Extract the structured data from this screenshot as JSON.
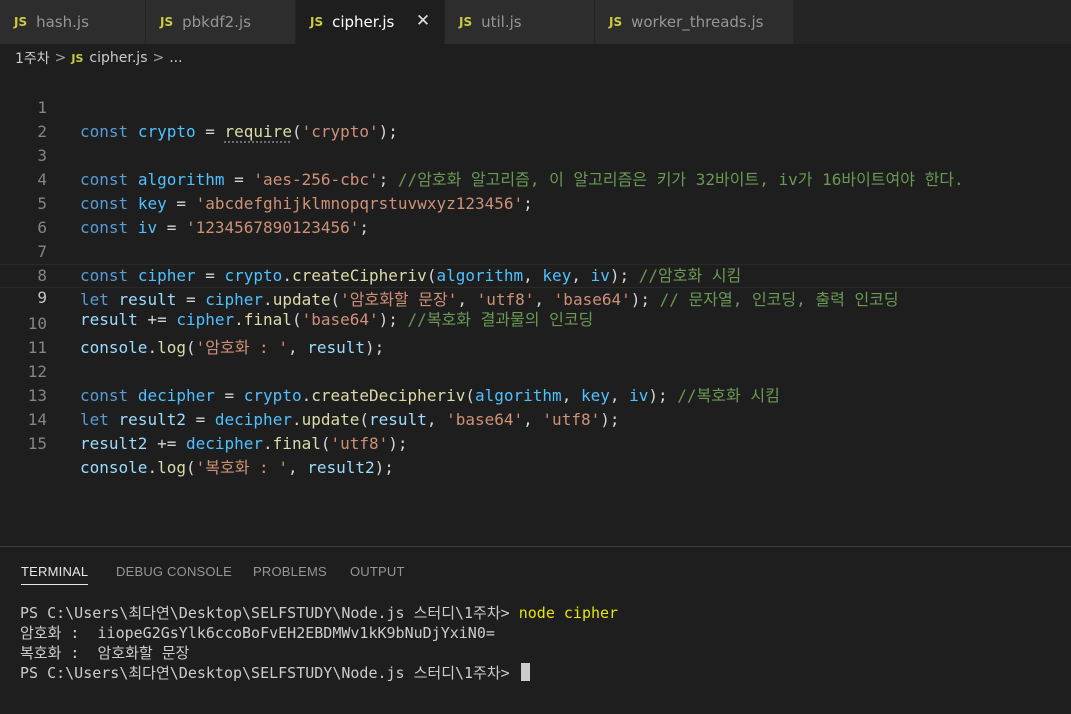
{
  "tabs": [
    {
      "icon": "JS",
      "label": "hash.js",
      "active": false
    },
    {
      "icon": "JS",
      "label": "pbkdf2.js",
      "active": false
    },
    {
      "icon": "JS",
      "label": "cipher.js",
      "active": true,
      "close": "✕"
    },
    {
      "icon": "JS",
      "label": "util.js",
      "active": false
    },
    {
      "icon": "JS",
      "label": "worker_threads.js",
      "active": false
    }
  ],
  "breadcrumb": {
    "folder": "1주차",
    "separator": ">",
    "file_icon": "JS",
    "file": "cipher.js",
    "more": "..."
  },
  "code": {
    "line_numbers": [
      "1",
      "2",
      "3",
      "4",
      "5",
      "6",
      "7",
      "8",
      "9",
      "10",
      "11",
      "12",
      "13",
      "14",
      "15"
    ],
    "current_line": 9,
    "lines": [
      "const crypto = require('crypto');",
      "",
      "const algorithm = 'aes-256-cbc'; //암호화 알고리즘, 이 알고리즘은 키가 32바이트, iv가 16바이트여야 한다.",
      "const key = 'abcdefghijklmnopqrstuvwxyz123456';",
      "const iv = '1234567890123456';",
      "",
      "const cipher = crypto.createCipheriv(algorithm, key, iv); //암호화 시킴",
      "let result = cipher.update('암호화할 문장', 'utf8', 'base64'); // 문자열, 인코딩, 출력 인코딩",
      "result += cipher.final('base64'); //복호화 결과물의 인코딩",
      "console.log('암호화 : ', result);",
      "",
      "const decipher = crypto.createDecipheriv(algorithm, key, iv); //복호화 시킴",
      "let result2 = decipher.update(result, 'base64', 'utf8');",
      "result2 += decipher.final('utf8');",
      "console.log('복호화 : ', result2);"
    ]
  },
  "panel": {
    "tabs": [
      "TERMINAL",
      "DEBUG CONSOLE",
      "PROBLEMS",
      "OUTPUT"
    ],
    "active_tab": "TERMINAL",
    "terminal": {
      "prompt": "PS C:\\Users\\최다연\\Desktop\\SELFSTUDY\\Node.js 스터디\\1주차> ",
      "command": "node cipher",
      "output": [
        "암호화 :  iiopeG2GsYlk6ccoBoFvEH2EBDMWv1kK9bNuDjYxiN0=",
        "복호화 :  암호화할 문장"
      ],
      "final_prompt": "PS C:\\Users\\최다연\\Desktop\\SELFSTUDY\\Node.js 스터디\\1주차>"
    }
  },
  "colors": {
    "background": "#1e1e1e",
    "keyword": "#569cd6",
    "string": "#ce9178",
    "comment": "#6a9955",
    "function": "#dcdcaa",
    "variable": "#4fc1ff",
    "js_icon": "#cbcb41",
    "terminal_command": "#e5e510"
  }
}
